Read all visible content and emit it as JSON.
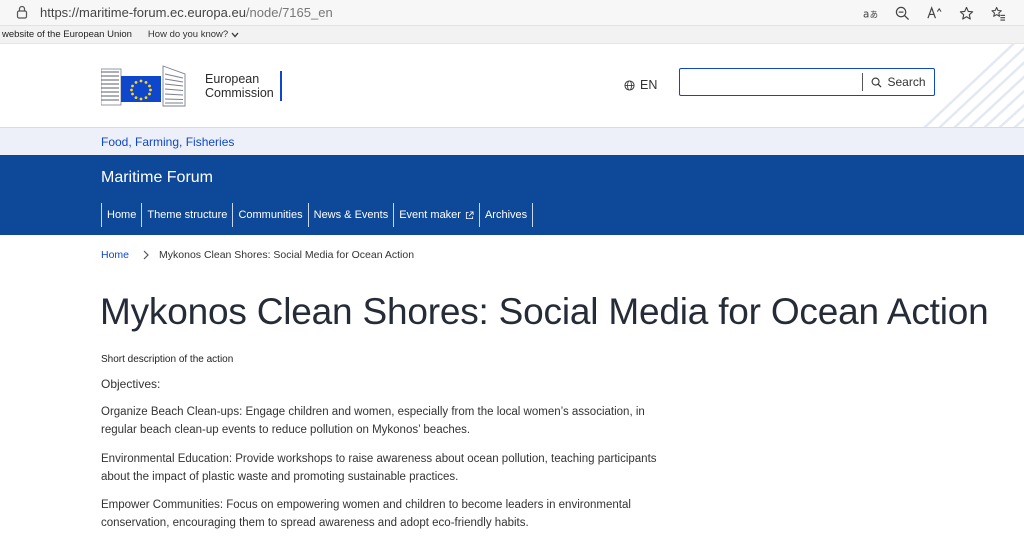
{
  "browser": {
    "url_base": "https://maritime-forum.ec.europa.eu",
    "url_path": "/node/7165_en",
    "tools": [
      "read-aloud-icon",
      "zoom-out-icon",
      "text-aa-icon",
      "favorite-star-icon",
      "favorites-list-icon"
    ]
  },
  "eu_bar": {
    "site_label": "website of the European Union",
    "know_label": "How do you know?"
  },
  "header": {
    "logo_line1": "European",
    "logo_line2": "Commission",
    "language": "EN",
    "search_placeholder": "",
    "search_label": "Search"
  },
  "site_section": {
    "label": "Food, Farming, Fisheries"
  },
  "banner": {
    "title": "Maritime Forum",
    "nav": [
      {
        "label": "Home"
      },
      {
        "label": "Theme structure"
      },
      {
        "label": "Communities"
      },
      {
        "label": "News & Events"
      },
      {
        "label": "Event maker"
      },
      {
        "label": "Archives"
      }
    ]
  },
  "breadcrumb": {
    "home": "Home",
    "current": "Mykonos Clean Shores: Social Media for Ocean Action"
  },
  "main": {
    "title": "Mykonos Clean Shores: Social Media for Ocean Action",
    "description_label": "Short description of the action",
    "objectives_label": "Objectives:",
    "paragraphs": [
      "Organize Beach Clean-ups: Engage children and women, especially from the local women’s association, in regular beach clean-up events to reduce pollution on Mykonos’ beaches.",
      "Environmental Education: Provide workshops to raise awareness about ocean pollution, teaching participants about the impact of plastic waste and promoting sustainable practices.",
      "Empower Communities: Focus on empowering women and children to become leaders in environmental conservation, encouraging them to spread awareness and adopt eco-friendly habits."
    ]
  },
  "colors": {
    "brand_blue": "#0d4899",
    "link_blue": "#0e47cb",
    "section_bg": "#edf0f8"
  }
}
